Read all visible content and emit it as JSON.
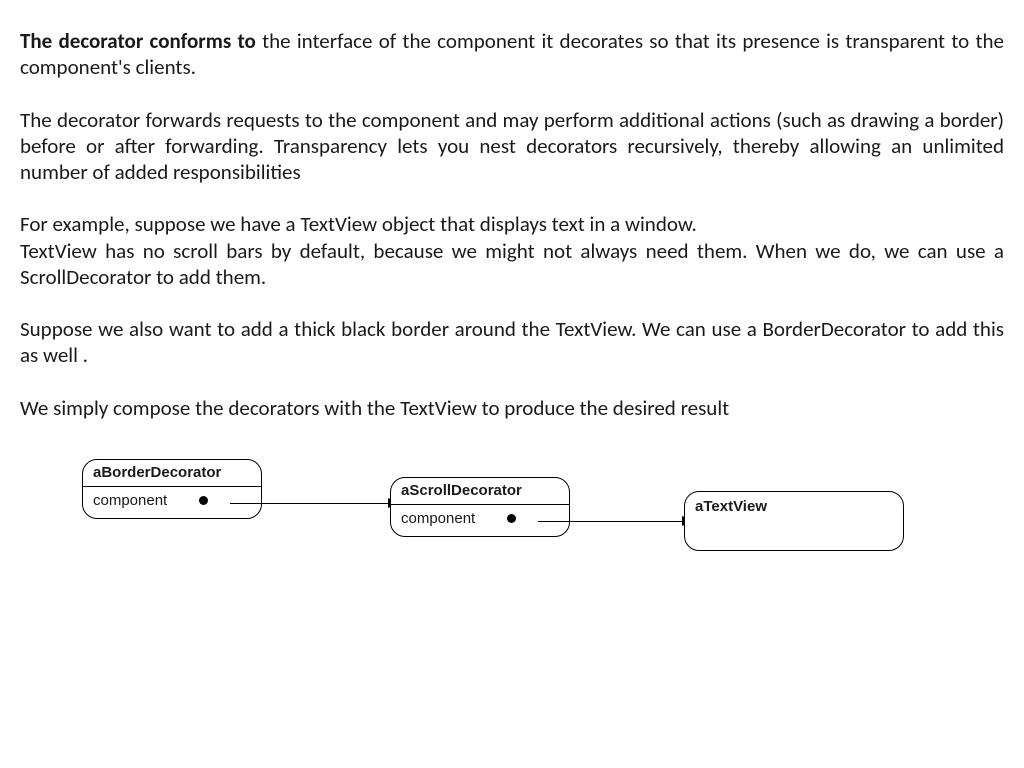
{
  "paragraphs": {
    "p1_bold": "The decorator conforms to",
    "p1_rest": " the interface of the component it decorates so that its presence is transparent to the component's clients.",
    "p2": "The decorator forwards requests to the component and may perform additional actions (such as drawing a border) before or after forwarding. Transparency lets you nest decorators recursively, thereby allowing an unlimited number of added responsibilities",
    "p3_line1": "For example, suppose we have a TextView object that displays text in a window.",
    "p3_line2": "TextView has no scroll bars by default, because we might not always need them. When we do, we can use a ScrollDecorator to add them.",
    "p4": "Suppose we also want to add a thick black border around the TextView. We can use a BorderDecorator to add this as well .",
    "p5": "We simply compose the decorators with the TextView to produce the desired result"
  },
  "diagram": {
    "box1": {
      "title": "aBorderDecorator",
      "slot": "component"
    },
    "box2": {
      "title": "aScrollDecorator",
      "slot": "component"
    },
    "box3": {
      "title": "aTextView"
    }
  }
}
